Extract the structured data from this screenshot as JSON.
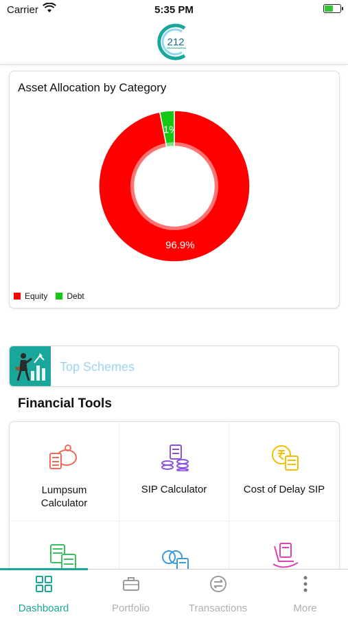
{
  "status_bar": {
    "carrier": "Carrier",
    "time": "5:35 PM"
  },
  "header": {
    "logo_text": "212"
  },
  "allocation": {
    "title": "Asset Allocation by Category",
    "colors": {
      "equity": "#ff0000",
      "debt": "#14c814"
    }
  },
  "chart_data": {
    "type": "pie",
    "title": "Asset Allocation by Category",
    "donut": true,
    "slices": [
      {
        "label": "Equity",
        "value": 96.9,
        "display": "96.9%",
        "color": "#ff0000"
      },
      {
        "label": "Debt",
        "value": 3.1,
        "display": "3.1%",
        "color": "#14c814"
      }
    ],
    "legend": [
      "Equity",
      "Debt"
    ],
    "legend_position": "bottom-left"
  },
  "top_schemes": {
    "label": "Top Schemes"
  },
  "financial_tools": {
    "title": "Financial Tools",
    "items": [
      {
        "label_lines": [
          "Lumpsum",
          "Calculator"
        ],
        "icon": "piggy-bank-calculator-icon",
        "color": "#f06a5a"
      },
      {
        "label_lines": [
          "SIP Calculator"
        ],
        "icon": "coins-calculator-icon",
        "color": "#8a52e0"
      },
      {
        "label_lines": [
          "Cost of Delay SIP"
        ],
        "icon": "rupee-calculator-icon",
        "color": "#f0c000"
      },
      {
        "label_lines": [
          ""
        ],
        "icon": "green-calculator-icon",
        "color": "#3cc060"
      },
      {
        "label_lines": [
          ""
        ],
        "icon": "rings-calculator-icon",
        "color": "#3b9ad8"
      },
      {
        "label_lines": [
          ""
        ],
        "icon": "rocking-chair-icon",
        "color": "#e040b0"
      }
    ]
  },
  "tabbar": {
    "items": [
      {
        "label": "Dashboard",
        "icon": "grid-icon",
        "active": true
      },
      {
        "label": "Portfolio",
        "icon": "briefcase-icon",
        "active": false
      },
      {
        "label": "Transactions",
        "icon": "exchange-icon",
        "active": false
      },
      {
        "label": "More",
        "icon": "more-vertical-icon",
        "active": false
      }
    ],
    "active_color": "#1aa79b",
    "inactive_color": "#b0b0b0"
  }
}
